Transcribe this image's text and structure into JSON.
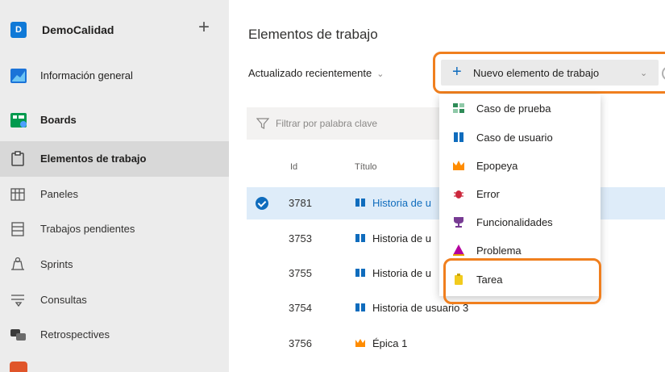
{
  "sidebar": {
    "project": {
      "initial": "D",
      "name": "DemoCalidad"
    },
    "items": [
      {
        "label": "Información general",
        "icon": "overview-icon"
      },
      {
        "label": "Boards",
        "icon": "boards-icon"
      },
      {
        "label": "Elementos de trabajo",
        "icon": "work-items-icon"
      },
      {
        "label": "Paneles",
        "icon": "panels-icon"
      },
      {
        "label": "Trabajos pendientes",
        "icon": "backlogs-icon"
      },
      {
        "label": "Sprints",
        "icon": "sprints-icon"
      },
      {
        "label": "Consultas",
        "icon": "queries-icon"
      },
      {
        "label": "Retrospectives",
        "icon": "retrospectives-icon"
      }
    ]
  },
  "main": {
    "title": "Elementos de trabajo",
    "view_selector": "Actualizado recientemente",
    "new_button": "Nuevo elemento de trabajo",
    "filter_placeholder": "Filtrar por palabra clave",
    "columns": {
      "id": "Id",
      "title": "Título"
    },
    "rows": [
      {
        "id": "3781",
        "title": "Historia de u",
        "type": "user-story",
        "selected": true
      },
      {
        "id": "3753",
        "title": "Historia de u",
        "type": "user-story",
        "selected": false
      },
      {
        "id": "3755",
        "title": "Historia de u",
        "type": "user-story",
        "selected": false
      },
      {
        "id": "3754",
        "title": "Historia de usuario 3",
        "type": "user-story",
        "selected": false
      },
      {
        "id": "3756",
        "title": "Épica 1",
        "type": "epic",
        "selected": false
      }
    ]
  },
  "dropdown": {
    "items": [
      {
        "label": "Caso de prueba",
        "icon": "test-case-icon",
        "color": "#2e8b57"
      },
      {
        "label": "Caso de usuario",
        "icon": "user-story-icon",
        "color": "#0f6cbd"
      },
      {
        "label": "Epopeya",
        "icon": "epic-icon",
        "color": "#ff8c00"
      },
      {
        "label": "Error",
        "icon": "bug-icon",
        "color": "#cc293d"
      },
      {
        "label": "Funcionalidades",
        "icon": "feature-icon",
        "color": "#773b93"
      },
      {
        "label": "Problema",
        "icon": "issue-icon",
        "color": "#b4009e"
      },
      {
        "label": "Tarea",
        "icon": "task-icon",
        "color": "#f2cb1d"
      }
    ]
  },
  "colors": {
    "accent": "#0f6cbd",
    "highlight": "#f07f1e",
    "selected_row": "#deecf9"
  }
}
